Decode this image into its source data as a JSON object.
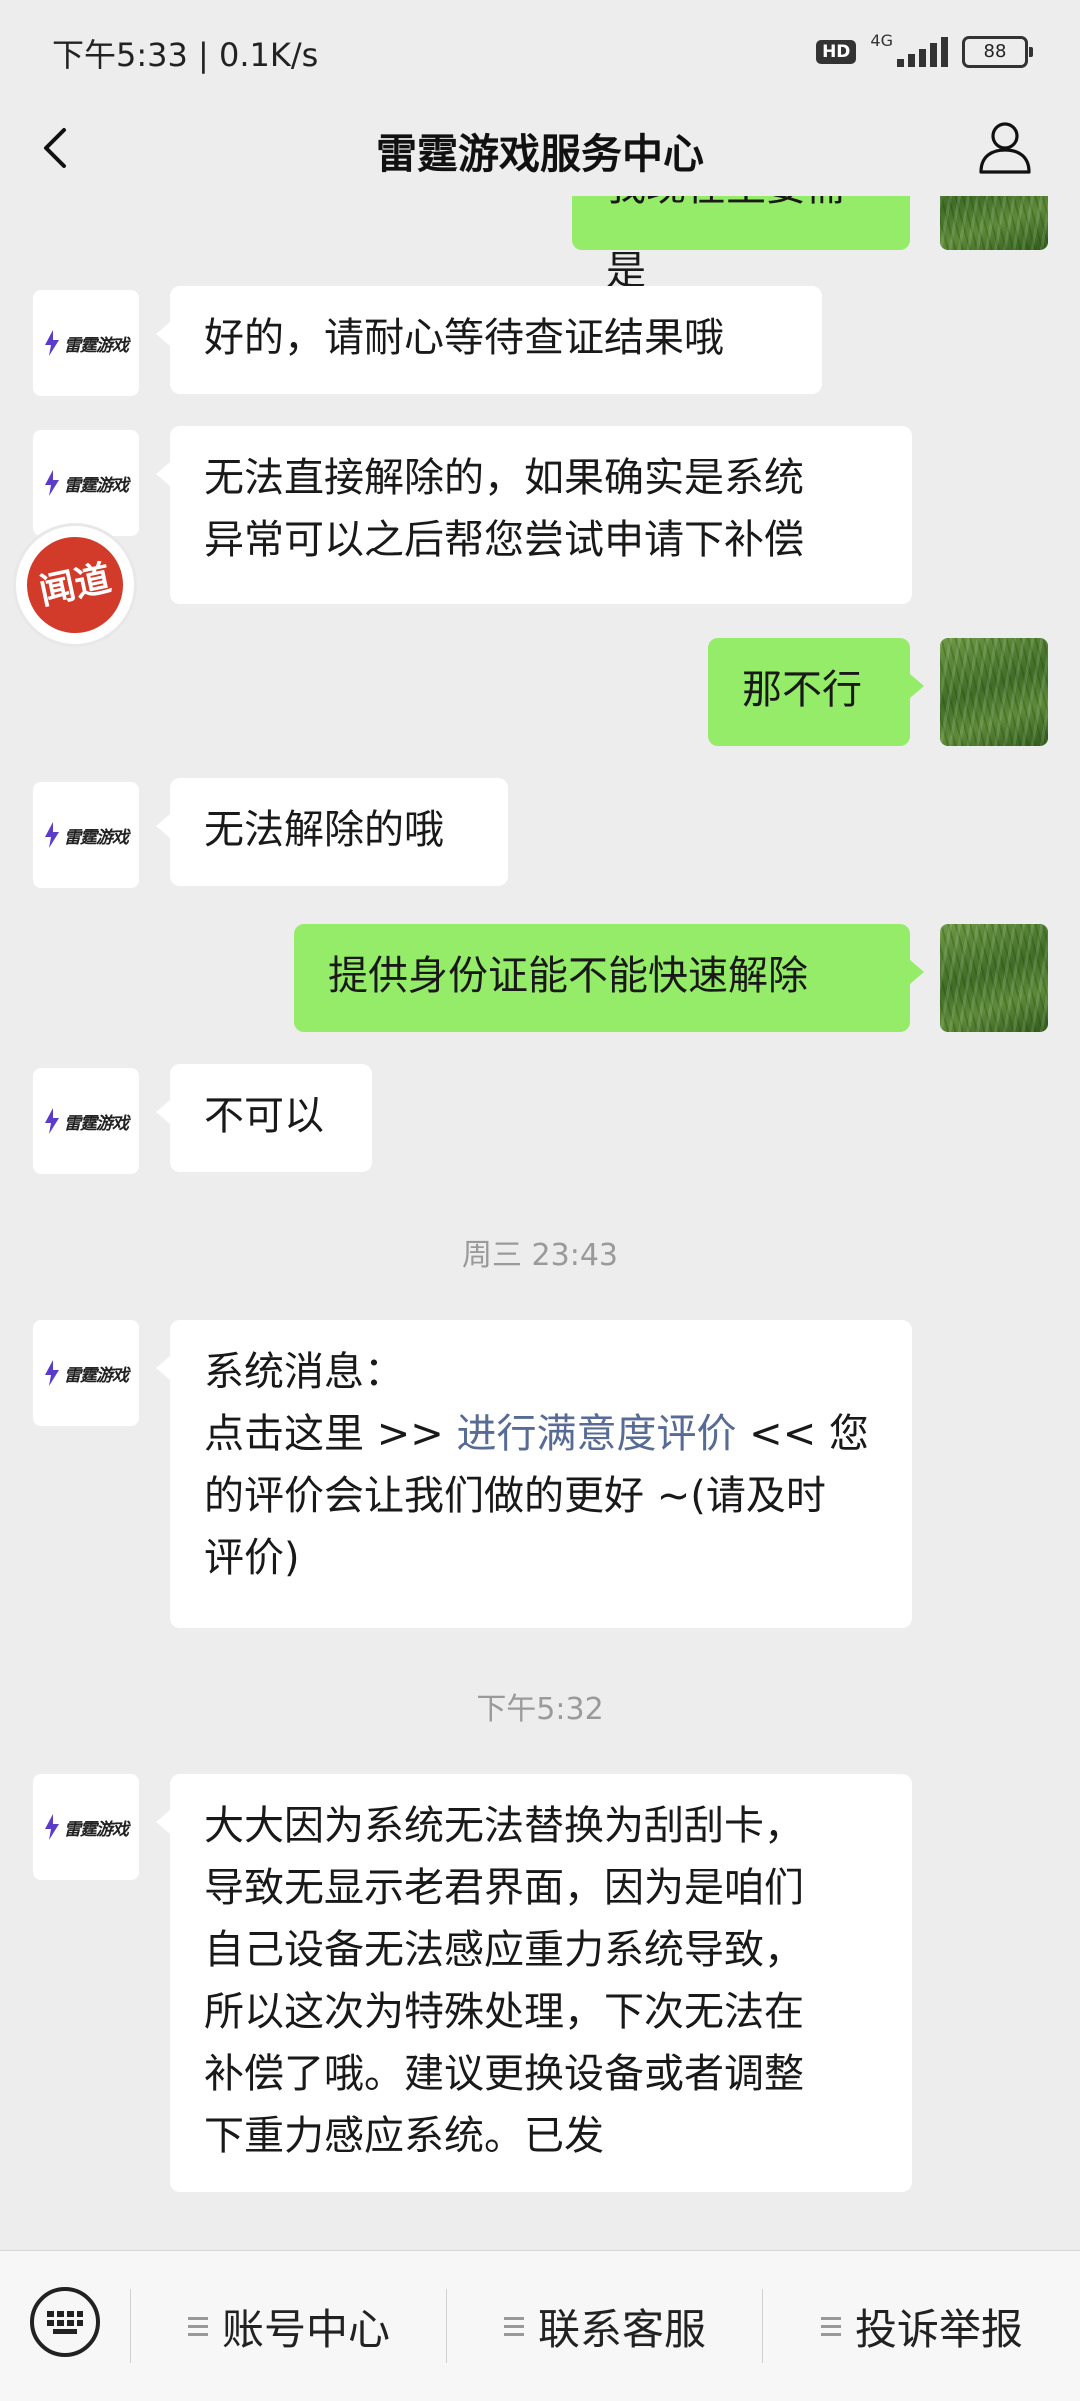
{
  "status_bar": {
    "time_speed": "下午5:33 | 0.1K/s",
    "hd": "HD",
    "network": "4G",
    "battery": "88"
  },
  "nav": {
    "title": "雷霆游戏服务中心"
  },
  "brand": {
    "avatar_text": "雷霆游戏"
  },
  "seal": {
    "text": "闻道"
  },
  "messages": {
    "m0": "我现在主要需是",
    "m1": "好的，请耐心等待查证结果哦",
    "m2_line1": "无法直接解除的，如果确实是系统",
    "m2_line2": "异常可以之后帮您尝试申请下补偿",
    "m3": "那不行",
    "m4": "无法解除的哦",
    "m5": "提供身份证能不能快速解除",
    "m6": "不可以",
    "time1": "周三 23:43",
    "m7_line1": "系统消息：",
    "m7_pre": "点击这里 >> ",
    "m7_link": "进行满意度评价",
    "m7_post": " << 您",
    "m7_line3": "的评价会让我们做的更好 ~(请及时",
    "m7_line4": "评价)",
    "time2": "下午5:32",
    "m8_line1": "大大因为系统无法替换为刮刮卡，",
    "m8_line2": "导致无显示老君界面，因为是咱们",
    "m8_line3": "自己设备无法感应重力系统导致，",
    "m8_line4": "所以这次为特殊处理，下次无法在",
    "m8_line5": "补偿了哦。建议更换设备或者调整",
    "m8_line6": "下重力感应系统。已发"
  },
  "bottom_menu": {
    "item1": "账号中心",
    "item2": "联系客服",
    "item3": "投诉举报"
  }
}
